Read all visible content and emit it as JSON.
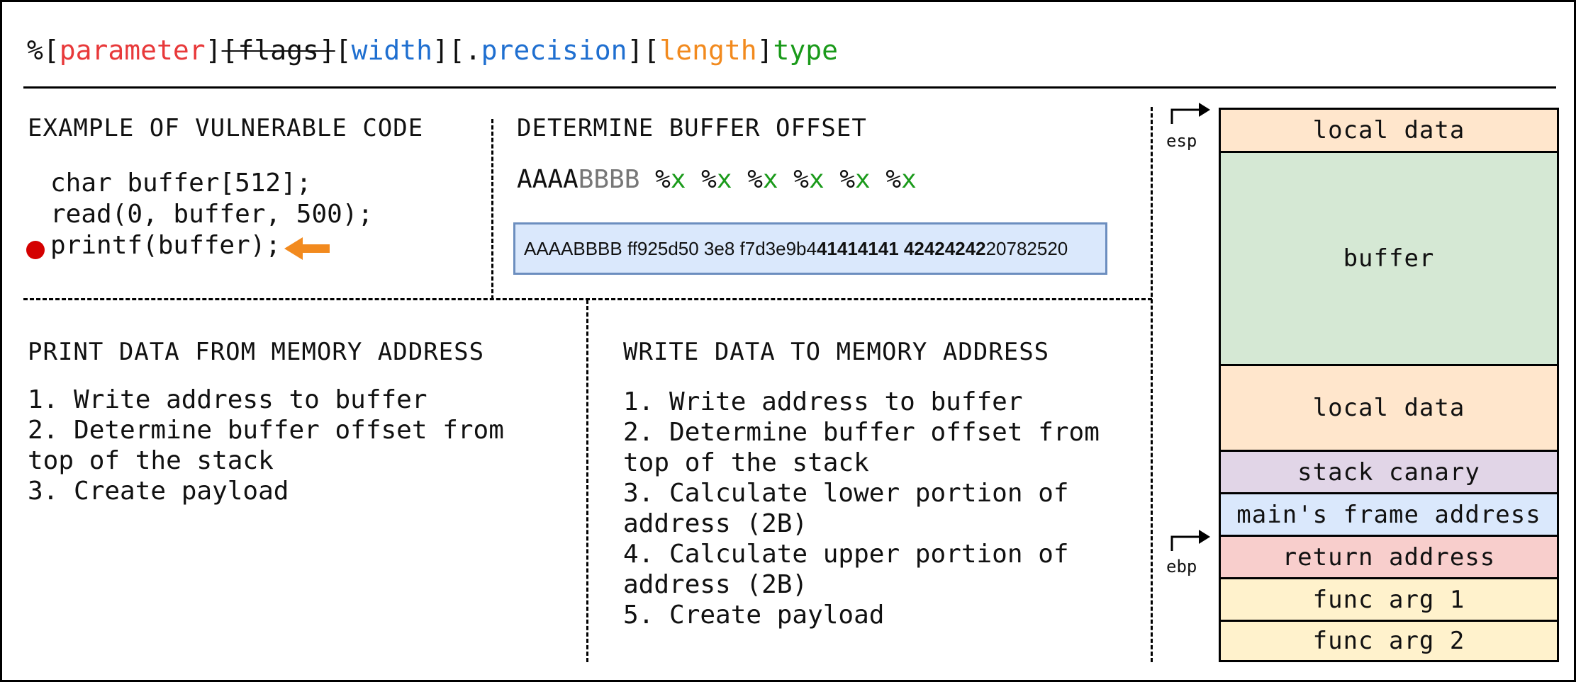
{
  "format_spec": {
    "open1": "%[",
    "parameter": "parameter",
    "close1": "]",
    "flags": "[flags]",
    "open2": "[",
    "width": "width",
    "close2": "][.",
    "precision": "precision",
    "close3": "][",
    "length": "length",
    "close4": "]",
    "type": "type"
  },
  "vulnerable_code": {
    "heading": "EXAMPLE OF VULNERABLE CODE",
    "lines": [
      "char buffer[512];",
      "read(0, buffer, 500);",
      "printf(buffer);"
    ]
  },
  "buffer_offset": {
    "heading": "DETERMINE BUFFER OFFSET",
    "input_a": "AAAA",
    "input_b": "BBBB",
    "specifiers": [
      {
        "pct": "%",
        "x": "x"
      },
      {
        "pct": "%",
        "x": "x"
      },
      {
        "pct": "%",
        "x": "x"
      },
      {
        "pct": "%",
        "x": "x"
      },
      {
        "pct": "%",
        "x": "x"
      },
      {
        "pct": "%",
        "x": "x"
      }
    ],
    "output_plain": "AAAABBBB ff925d50 3e8 f7d3e9b4 ",
    "output_bold_1": "41414141",
    "output_bold_2": "42424242",
    "output_tail": " 20782520"
  },
  "print_data": {
    "heading": "PRINT DATA FROM MEMORY ADDRESS",
    "steps": [
      "1. Write address to buffer",
      "2. Determine buffer offset from",
      "top of the stack",
      "3. Create payload"
    ]
  },
  "write_data": {
    "heading": "WRITE DATA TO MEMORY ADDRESS",
    "steps": [
      "1. Write address to buffer",
      "2. Determine buffer offset from",
      "top of the stack",
      "3. Calculate lower portion of",
      "address (2B)",
      "4. Calculate upper portion of",
      "address (2B)",
      "5. Create payload"
    ]
  },
  "stack": {
    "registers": {
      "esp": "esp",
      "ebp": "ebp"
    },
    "cells": [
      {
        "label": "local data",
        "color": "#ffe6cc"
      },
      {
        "label": "buffer",
        "color": "#d5e8d4"
      },
      {
        "label": "local data",
        "color": "#ffe6cc"
      },
      {
        "label": "stack canary",
        "color": "#e1d5e7"
      },
      {
        "label": "main's frame address",
        "color": "#dae8fc"
      },
      {
        "label": "return address",
        "color": "#f8cecc"
      },
      {
        "label": "func arg 1",
        "color": "#fff2cc"
      },
      {
        "label": "func arg 2",
        "color": "#fff2cc"
      }
    ]
  },
  "colors": {
    "red": "#e8393a",
    "blue": "#1f6fd0",
    "orange": "#f28a1e",
    "green": "#1a9a1a",
    "breakpoint": "#d40000"
  }
}
